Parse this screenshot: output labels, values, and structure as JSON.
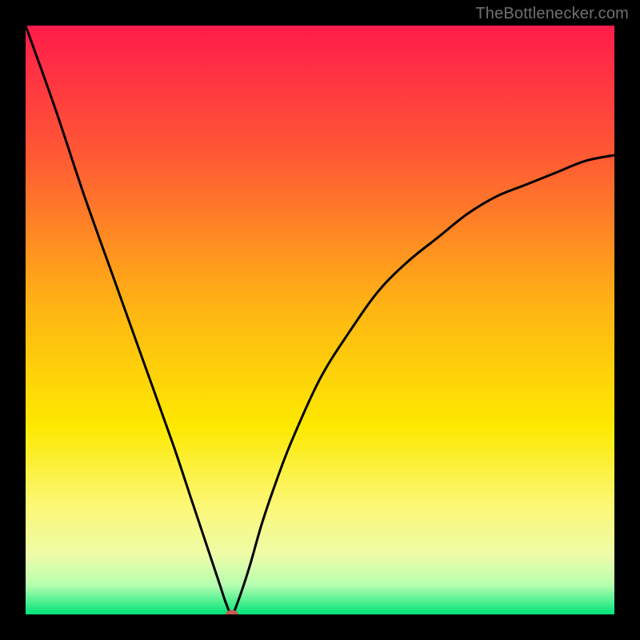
{
  "watermark": "TheBottlenecker.com",
  "chart_data": {
    "type": "line",
    "title": "",
    "xlabel": "",
    "ylabel": "",
    "xlim": [
      0,
      100
    ],
    "ylim": [
      0,
      100
    ],
    "series": [
      {
        "name": "bottleneck-curve",
        "x": [
          0,
          5,
          10,
          15,
          20,
          25,
          28,
          30,
          32,
          33,
          34,
          35,
          36,
          38,
          40,
          42,
          45,
          50,
          55,
          60,
          65,
          70,
          75,
          80,
          85,
          90,
          95,
          100
        ],
        "values": [
          100,
          86,
          71,
          57,
          43,
          29,
          20,
          14,
          8,
          5,
          2,
          0,
          2,
          8,
          15,
          21,
          29,
          40,
          48,
          55,
          60,
          64,
          68,
          71,
          73,
          75,
          77,
          78
        ]
      }
    ],
    "marker": {
      "x": 35,
      "y": 0
    },
    "gradient_stops": [
      {
        "offset": 0,
        "color": "#ff1c4b"
      },
      {
        "offset": 22,
        "color": "#ff5934"
      },
      {
        "offset": 48,
        "color": "#ffb514"
      },
      {
        "offset": 68,
        "color": "#fde900"
      },
      {
        "offset": 82,
        "color": "#fbf87a"
      },
      {
        "offset": 90,
        "color": "#edfca8"
      },
      {
        "offset": 95,
        "color": "#b6ffb0"
      },
      {
        "offset": 100,
        "color": "#00e47a"
      }
    ]
  }
}
